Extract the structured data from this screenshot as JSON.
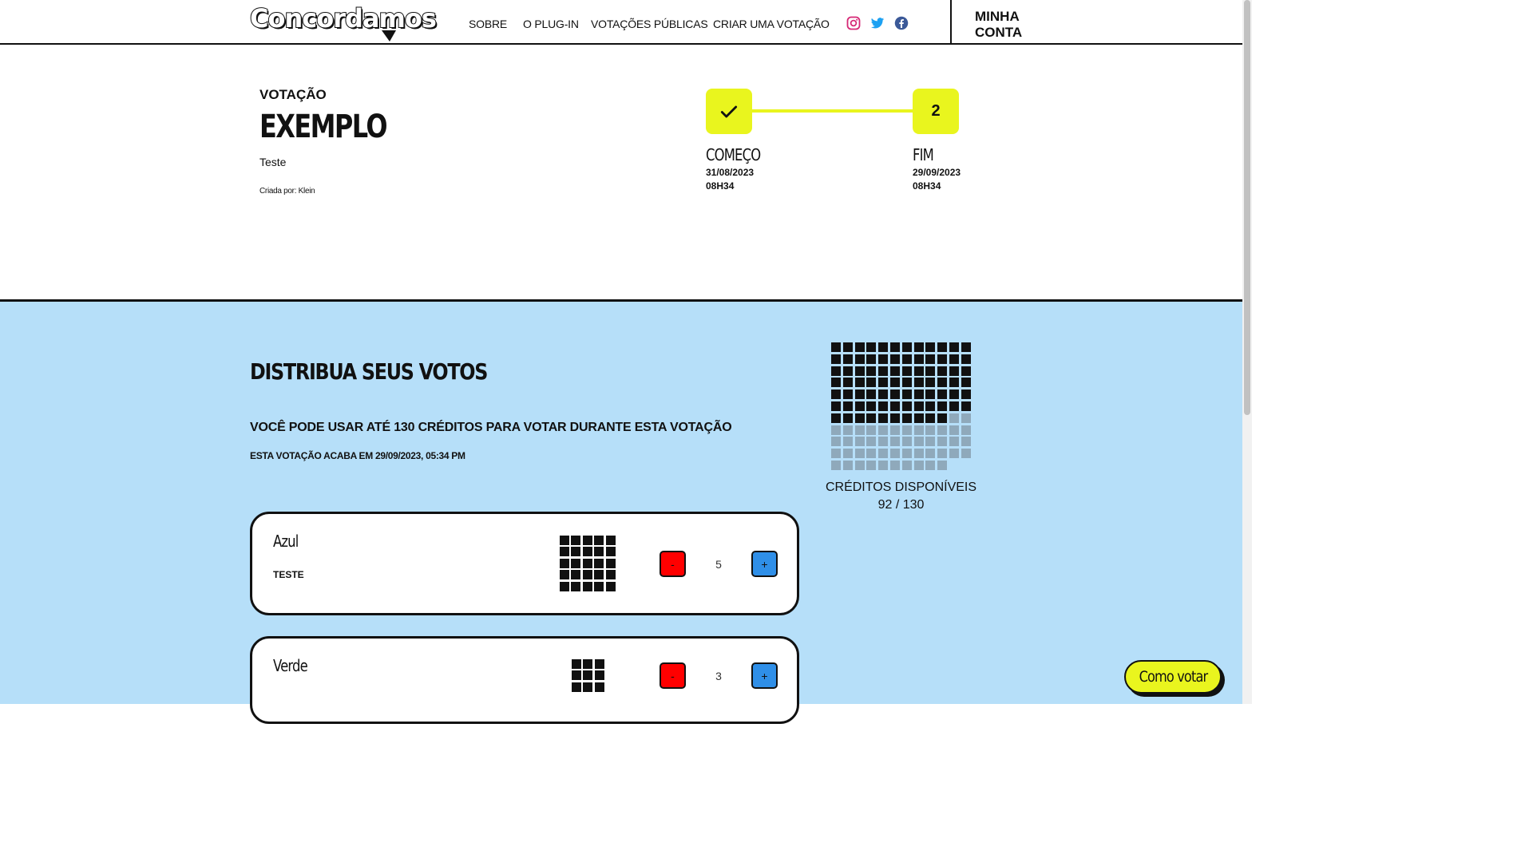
{
  "header": {
    "logo_text": "Concordamos",
    "nav": [
      "SOBRE",
      "O PLUG-IN",
      "VOTAÇÕES PÚBLICAS",
      "CRIAR UMA VOTAÇÃO"
    ],
    "social_icons": [
      "instagram-icon",
      "twitter-icon",
      "facebook-icon"
    ],
    "account_label_line1": "MINHA",
    "account_label_line2": "CONTA"
  },
  "voting": {
    "label": "VOTAÇÃO",
    "title": "EXEMPLO",
    "description": "Teste",
    "created_by": "Criada por: Klein"
  },
  "timeline": {
    "start": {
      "title": "COMEÇO",
      "date": "31/08/2023",
      "time": "08H34",
      "icon": "check-icon"
    },
    "end": {
      "step": "2",
      "title": "FIM",
      "date": "29/09/2023",
      "time": "08H34"
    }
  },
  "distribution": {
    "title": "DISTRIBUA SEUS VOTOS",
    "credits_info": "VOCÊ PODE USAR ATÉ 130 CRÉDITOS PARA VOTAR DURANTE ESTA VOTAÇÃO",
    "ends_info": "ESTA VOTAÇÃO ACABA EM 29/09/2023, 05:34 PM"
  },
  "credits": {
    "label": "CRÉDITOS DISPONÍVEIS",
    "value_text": "92 / 130",
    "used": 82,
    "total": 130
  },
  "options": [
    {
      "name": "Azul",
      "description": "TESTE",
      "votes": "5",
      "minus_label": "-",
      "plus_label": "+"
    },
    {
      "name": "Verde",
      "description": "",
      "votes": "3",
      "minus_label": "-",
      "plus_label": "+"
    }
  ],
  "howto_button": "Como votar",
  "colors": {
    "accent_yellow": "#e9f51e",
    "section_blue": "#b6dff9",
    "minus_red": "#ff0000",
    "plus_blue": "#2f8fe8",
    "credit_used": "#111111",
    "credit_available": "#8fa9bb"
  }
}
